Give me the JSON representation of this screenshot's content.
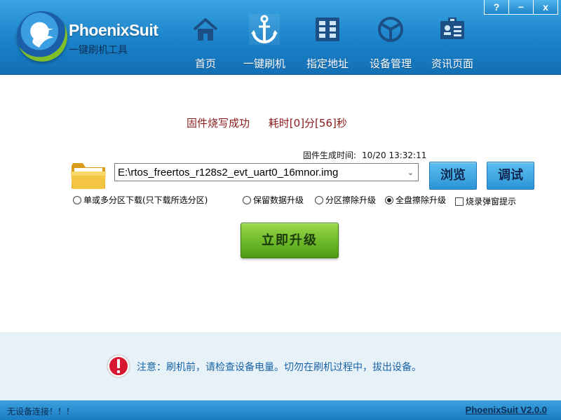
{
  "app": {
    "brand": "PhoenixSuit",
    "subtitle": "一键刷机工具",
    "version_link": "PhoenixSuit V2.0.0"
  },
  "window_controls": {
    "help": "?",
    "minimize": "−",
    "close": "x"
  },
  "nav": [
    {
      "label": "首页",
      "icon": "home-icon"
    },
    {
      "label": "一键刷机",
      "icon": "anchor-icon"
    },
    {
      "label": "指定地址",
      "icon": "grid-icon"
    },
    {
      "label": "设备管理",
      "icon": "cube-icon"
    },
    {
      "label": "资讯页面",
      "icon": "news-icon"
    }
  ],
  "main": {
    "status_text": "固件烧写成功",
    "elapsed_text": "耗时[0]分[56]秒",
    "gen_time_label": "固件生成时间:",
    "gen_time_value": "10/20 13:32:11",
    "firmware_path": "E:\\rtos_freertos_r128s2_evt_uart0_16mnor.img",
    "browse_label": "浏览",
    "debug_label": "调试",
    "options": {
      "single_multi_partition": "单或多分区下载(只下载所选分区)",
      "keep_data": "保留数据升级",
      "partition_erase": "分区擦除升级",
      "full_erase": "全盘擦除升级",
      "burn_popup": "烧录弹窗提示"
    },
    "selected_option": "full_erase",
    "upgrade_label": "立即升级"
  },
  "notice": {
    "text": "注意：刷机前，请检查设备电量。切勿在刷机过程中，拔出设备。"
  },
  "statusbar": {
    "device_status": "无设备连接！！！"
  },
  "colors": {
    "header": "#1a82c9",
    "status_red": "#8a1a1a",
    "notice_blue": "#1a63a6",
    "upgrade_green": "#6cb82a"
  }
}
